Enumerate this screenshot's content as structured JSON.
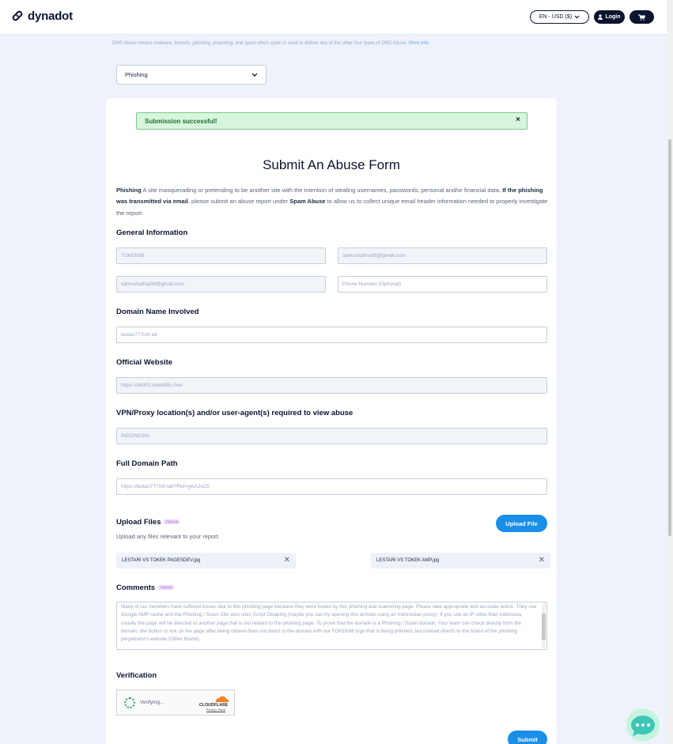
{
  "header": {
    "logo_text": "dynadot",
    "lang_label": "EN - USD ($)",
    "login_label": "Login",
    "cart_icon": "cart-icon"
  },
  "top_note": {
    "text": "DNS Abuse means malware, botnets, phishing, pharming, and spam when spam is used to deliver any of the other four types of DNS Abuse.",
    "link": "More Info"
  },
  "abuse_type": {
    "selected": "Phishing"
  },
  "alert": {
    "message": "Submission successful!",
    "close": "×"
  },
  "form": {
    "title": "Submit An Abuse Form",
    "intro": {
      "term": "Phishing",
      "definition": " A site masquerading or pretending to be another site with the intention of stealing usernames, passwords, personal and/or financial data. ",
      "bold_clause": "If the phishing was transmitted via email",
      "middle": ", please submit an abuse report under ",
      "spam_link": "Spam Abuse",
      "end": " to allow us to collect unique email header information needed to properly investigate the report."
    },
    "general": {
      "heading": "General Information",
      "name": "TOKEK88",
      "email": "samsuludina08@gmail.com",
      "confirm_email": "samsuludina08@gmail.com",
      "phone_placeholder": "Phone Number (Optional)"
    },
    "domain": {
      "heading": "Domain Name Involved",
      "value": "lestari777nih.lat"
    },
    "official": {
      "heading": "Official Website",
      "value": "https://ok002.tokek88c.live/"
    },
    "vpn": {
      "heading": "VPN/Proxy location(s) and/or user-agent(s) required to view abuse",
      "value": "INDONESIA"
    },
    "path": {
      "heading": "Full Domain Path",
      "value": "https://lestari777nih.lat/?Ref=jybAJxZS"
    },
    "upload": {
      "heading": "Upload Files",
      "optional": "Optional",
      "button": "Upload File",
      "subtitle": "Upload any files relevant to your report.",
      "files": [
        "LESTARI VS TOKEK PAGESDEV.jpg",
        "LESTARI VS TOKEK AMP.jpg"
      ]
    },
    "comments": {
      "heading": "Comments",
      "optional": "Optional",
      "text": "domain which is actually very dangerous which we investigated, it has ...... very dangerous domain through your registrar. We have also tried to report this domain to the hosting provider. Many of our members have suffered losses due to this phishing page because they were fooled by this phishing and scamming page. Please take appropriate and accurate action. They use Google AMP cache and the Phishing / Scam Site also uses Script Cloaking (maybe you can try opening this domain using an Indonesian proxy). If you use an IP other than Indonesia, usually the page will be directed to another page that is not related to the phishing page. To prove that the domain is a Phishing / Scam domain. Your team can check directly from the domain, the button or link on the page after being clicked does not direct to the domain with our TOKEK88 logo that is being phished, but instead directs to the brand of the phishing perpetrator's website (Other Brand)."
    },
    "verification": {
      "heading": "Verification",
      "status": "Verifying...",
      "provider": "CLOUDFLARE",
      "links": "Privacy • Terms"
    },
    "submit": "Submit"
  },
  "colors": {
    "accent": "#1a8fe8",
    "navy": "#0b1530",
    "success_bg": "#d8f6dd",
    "page_bg": "#eef3fb"
  }
}
